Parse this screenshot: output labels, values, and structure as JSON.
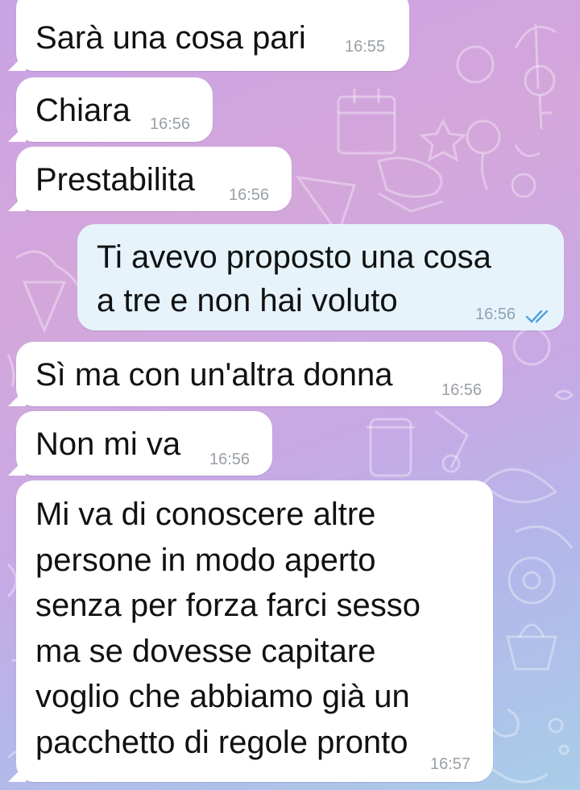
{
  "messages": [
    {
      "direction": "incoming",
      "text": "Sarà una cosa pari",
      "time": "16:55"
    },
    {
      "direction": "incoming",
      "text": "Chiara",
      "time": "16:56"
    },
    {
      "direction": "incoming",
      "text": "Prestabilita",
      "time": "16:56"
    },
    {
      "direction": "outgoing",
      "text": "Ti avevo proposto una cosa\na tre e non hai voluto",
      "time": "16:56",
      "status_icon": "double-check-icon",
      "status_color": "#4fa3e0"
    },
    {
      "direction": "incoming",
      "text": "Sì ma con un'altra donna",
      "time": "16:56"
    },
    {
      "direction": "incoming",
      "text": "Non mi va",
      "time": "16:56"
    },
    {
      "direction": "incoming",
      "text": "Mi va di conoscere altre\npersone in modo aperto\nsenza per forza farci sesso\nma se dovesse capitare\nvoglio che abbiamo già un\npacchetto di regole pronto",
      "time": "16:57"
    }
  ],
  "colors": {
    "incoming_bubble": "#ffffff",
    "outgoing_bubble": "#e6f3fb",
    "timestamp": "#9aa0a6",
    "read_ticks": "#4fa3e0"
  }
}
